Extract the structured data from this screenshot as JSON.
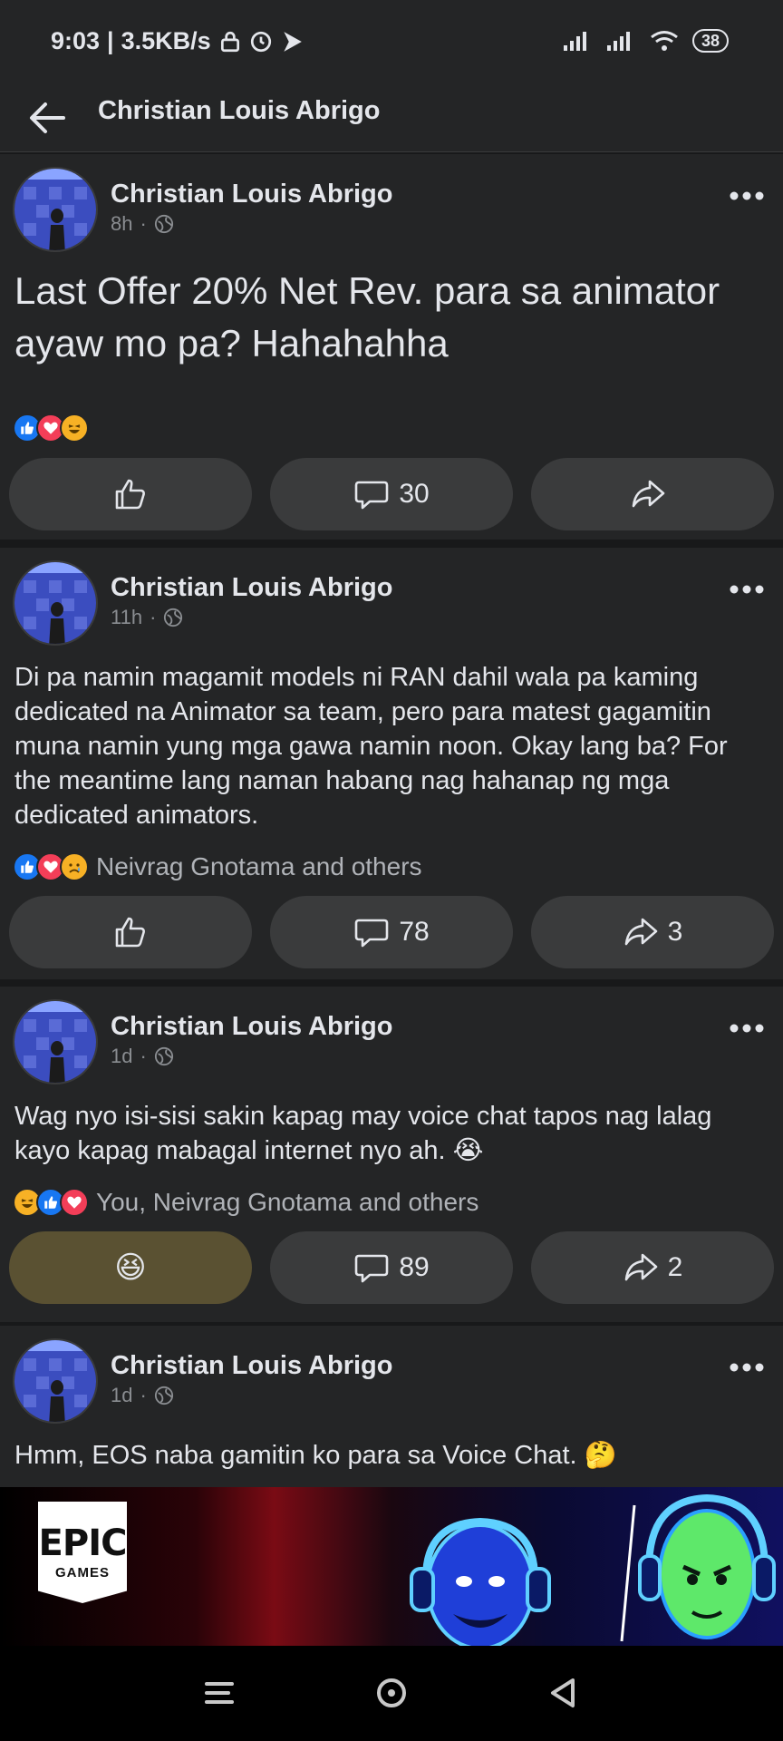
{
  "status_bar": {
    "time": "9:03",
    "separator": "|",
    "net_speed": "3.5KB/s",
    "battery": "38",
    "icons": [
      "lock-icon",
      "clock-icon",
      "play-icon",
      "signal-icon",
      "signal-icon",
      "wifi-icon",
      "battery-icon"
    ]
  },
  "app_bar": {
    "title": "Christian Louis Abrigo"
  },
  "posts": [
    {
      "author": "Christian Louis Abrigo",
      "time": "8h",
      "dot": "·",
      "text": "Last Offer 20% Net Rev. para sa animator ayaw mo pa? Hahahahha",
      "reaction_icons": [
        "like",
        "love",
        "haha"
      ],
      "reaction_label": "",
      "comment_count": "30",
      "share_count": ""
    },
    {
      "author": "Christian Louis Abrigo",
      "time": "11h",
      "dot": "·",
      "text": "Di pa namin magamit models ni RAN dahil wala pa kaming dedicated na Animator sa team, pero para matest gagamitin muna namin yung mga gawa namin noon. Okay lang ba? For the meantime lang naman habang nag hahanap ng mga dedicated animators.",
      "reaction_icons": [
        "like",
        "love",
        "sad"
      ],
      "reaction_label": "Neivrag Gnotama and others",
      "comment_count": "78",
      "share_count": "3"
    },
    {
      "author": "Christian Louis Abrigo",
      "time": "1d",
      "dot": "·",
      "text": "Wag nyo isi-sisi sakin kapag may voice chat tapos nag lalag kayo kapag mabagal internet nyo ah. 😭",
      "reaction_icons": [
        "haha",
        "like",
        "love"
      ],
      "reaction_label": "You, Neivrag Gnotama and others",
      "comment_count": "89",
      "share_count": "2",
      "my_reaction": "😆"
    },
    {
      "author": "Christian Louis Abrigo",
      "time": "1d",
      "dot": "·",
      "text": "Hmm, EOS naba gamitin ko para sa Voice Chat. 🤔"
    }
  ],
  "ad": {
    "logo_line1": "EPIC",
    "logo_line2": "GAMES"
  },
  "colors": {
    "background": "#18191a",
    "card": "#242526",
    "button": "#3a3b3c",
    "text": "#e4e6eb",
    "muted": "#8a8d91",
    "like": "#1877f2",
    "love": "#f33e58",
    "haha": "#f7b125"
  }
}
